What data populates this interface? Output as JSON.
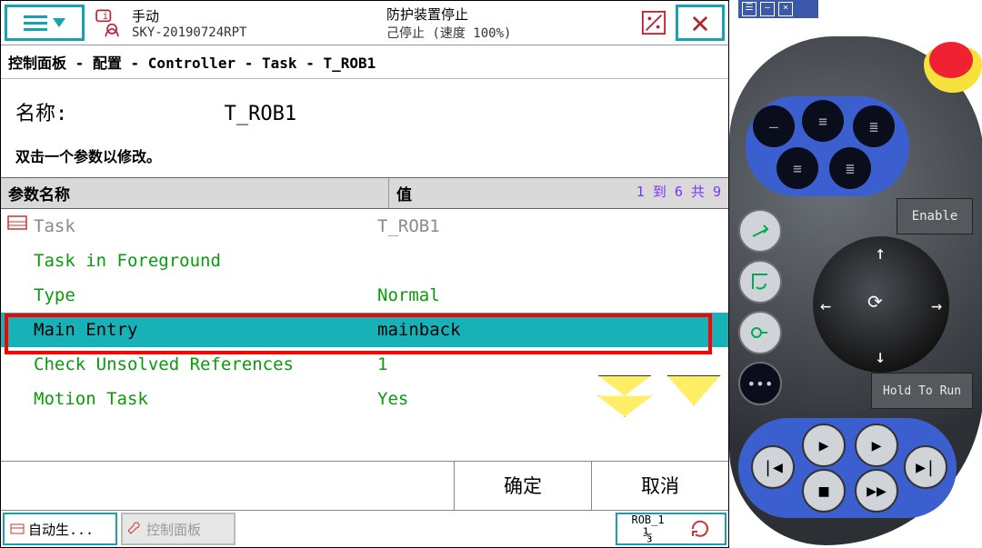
{
  "topbar": {
    "mode": "手动",
    "station": "SKY-20190724RPT",
    "guard": "防护装置停止",
    "state": "己停止 (速度 100%)"
  },
  "breadcrumb": "控制面板 - 配置 - Controller - Task - T_ROB1",
  "name_label": "名称:",
  "name_value": "T_ROB1",
  "hint": "双击一个参数以修改。",
  "headers": {
    "param": "参数名称",
    "value": "值",
    "range": "1 到 6 共 9"
  },
  "rows": [
    {
      "name": "Task",
      "value": "T_ROB1",
      "cls": "gray"
    },
    {
      "name": "Task in Foreground",
      "value": "",
      "cls": "green"
    },
    {
      "name": "Type",
      "value": "Normal",
      "cls": "green"
    },
    {
      "name": "Main Entry",
      "value": "mainback",
      "cls": "sel"
    },
    {
      "name": "Check Unsolved References",
      "value": "1",
      "cls": "green"
    },
    {
      "name": "Motion Task",
      "value": "Yes",
      "cls": "green"
    }
  ],
  "buttons": {
    "ok": "确定",
    "cancel": "取消"
  },
  "taskbar": {
    "t1": "自动生...",
    "t2": "控制面板",
    "rob": "ROB_1",
    "frac": "⅓"
  },
  "pendant": {
    "enable": "Enable",
    "hold": "Hold To Run"
  }
}
